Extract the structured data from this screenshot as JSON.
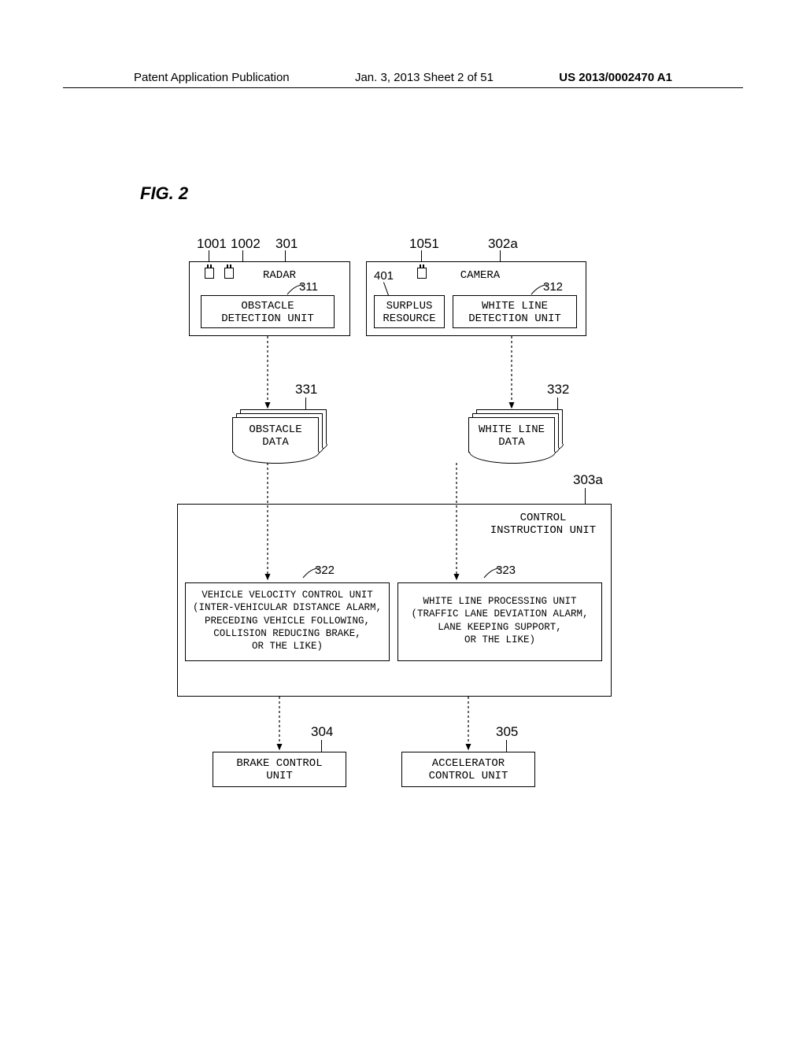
{
  "header": {
    "left": "Patent Application Publication",
    "center": "Jan. 3, 2013  Sheet 2 of 51",
    "right": "US 2013/0002470 A1"
  },
  "fig": "FIG. 2",
  "refs": {
    "r1001": "1001",
    "r1002": "1002",
    "r301": "301",
    "r1051": "1051",
    "r302a": "302a",
    "r311": "311",
    "r401": "401",
    "r312": "312",
    "r331": "331",
    "r332": "332",
    "r303a": "303a",
    "r322": "322",
    "r323": "323",
    "r304": "304",
    "r305": "305"
  },
  "labels": {
    "radar": "RADAR",
    "camera": "CAMERA",
    "obstacle_detect": "OBSTACLE\nDETECTION UNIT",
    "surplus": "SURPLUS\nRESOURCE",
    "white_line_detect": "WHITE LINE\nDETECTION UNIT",
    "obstacle_data": "OBSTACLE\nDATA",
    "white_line_data": "WHITE LINE\nDATA",
    "control_instr": "CONTROL\nINSTRUCTION UNIT",
    "vehicle_velocity": "VEHICLE VELOCITY CONTROL UNIT\n(INTER-VEHICULAR DISTANCE ALARM,\nPRECEDING VEHICLE FOLLOWING,\nCOLLISION REDUCING BRAKE,\nOR THE LIKE)",
    "white_line_proc": "WHITE LINE PROCESSING UNIT\n(TRAFFIC LANE DEVIATION ALARM,\nLANE KEEPING SUPPORT,\nOR THE LIKE)",
    "brake": "BRAKE CONTROL\nUNIT",
    "accel": "ACCELERATOR\nCONTROL UNIT"
  }
}
